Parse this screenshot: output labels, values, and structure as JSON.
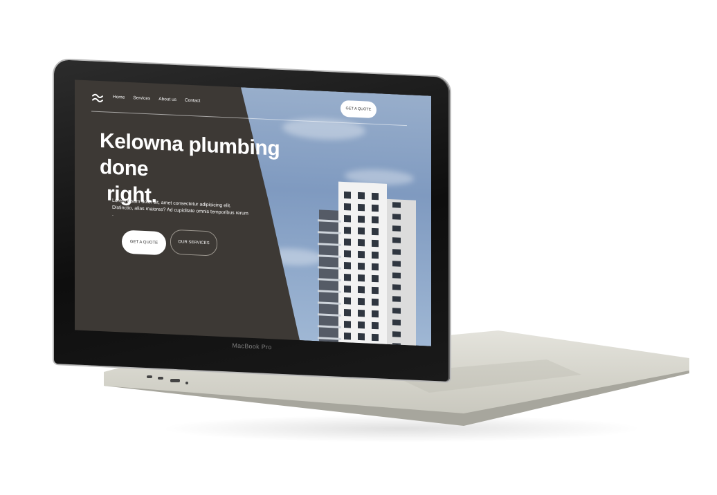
{
  "laptop": {
    "brand_label": "MacBook Pro"
  },
  "website": {
    "logo_icon": "waves-icon",
    "nav": {
      "items": [
        {
          "label": "Home"
        },
        {
          "label": "Services"
        },
        {
          "label": "About us"
        },
        {
          "label": "Contact"
        }
      ],
      "cta_label": "GET A QUOTE"
    },
    "hero": {
      "title_line1": "Kelowna plumbing done",
      "title_line2": "right.",
      "text": "Lorem ipsum dolor sit, amet consectetur adipisicing elit. Distinctio, alias maiores? Ad cupiditate omnis temporibus rerum .",
      "primary_button": "GET A QUOTE",
      "secondary_button": "OUR SERVICES"
    },
    "colors": {
      "background": "#3d3935",
      "text": "#ffffff",
      "button": "#ffffff",
      "sky": "#8fa8c8"
    }
  }
}
